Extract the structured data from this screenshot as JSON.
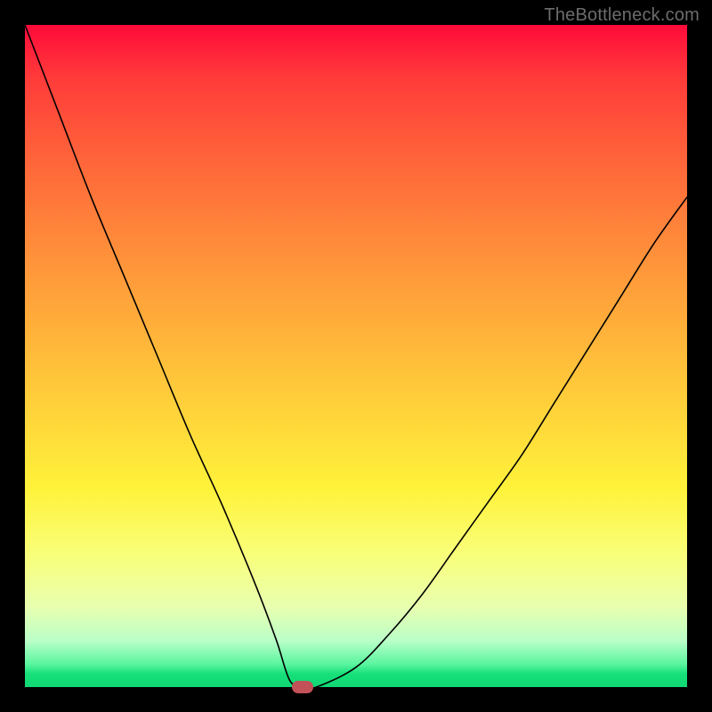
{
  "watermark": "TheBottleneck.com",
  "chart_data": {
    "type": "line",
    "title": "",
    "xlabel": "",
    "ylabel": "",
    "xlim": [
      0,
      100
    ],
    "ylim": [
      0,
      100
    ],
    "grid": false,
    "legend": false,
    "series": [
      {
        "name": "curve",
        "x": [
          0,
          5,
          10,
          15,
          20,
          25,
          30,
          35,
          38,
          40,
          42,
          44,
          50,
          55,
          60,
          65,
          70,
          75,
          80,
          85,
          90,
          95,
          100
        ],
        "y": [
          100,
          87,
          74,
          62,
          50,
          38,
          27,
          15,
          7,
          1,
          0,
          0,
          3,
          8,
          14,
          21,
          28,
          35,
          43,
          51,
          59,
          67,
          74
        ]
      }
    ],
    "marker": {
      "x": 42,
      "y": 0,
      "color": "#c25258"
    },
    "gradient_stops": [
      {
        "pos": 0,
        "color": "#ff0a3a"
      },
      {
        "pos": 0.55,
        "color": "#ffca3a"
      },
      {
        "pos": 0.8,
        "color": "#f9ff7a"
      },
      {
        "pos": 1.0,
        "color": "#10d874"
      }
    ]
  }
}
